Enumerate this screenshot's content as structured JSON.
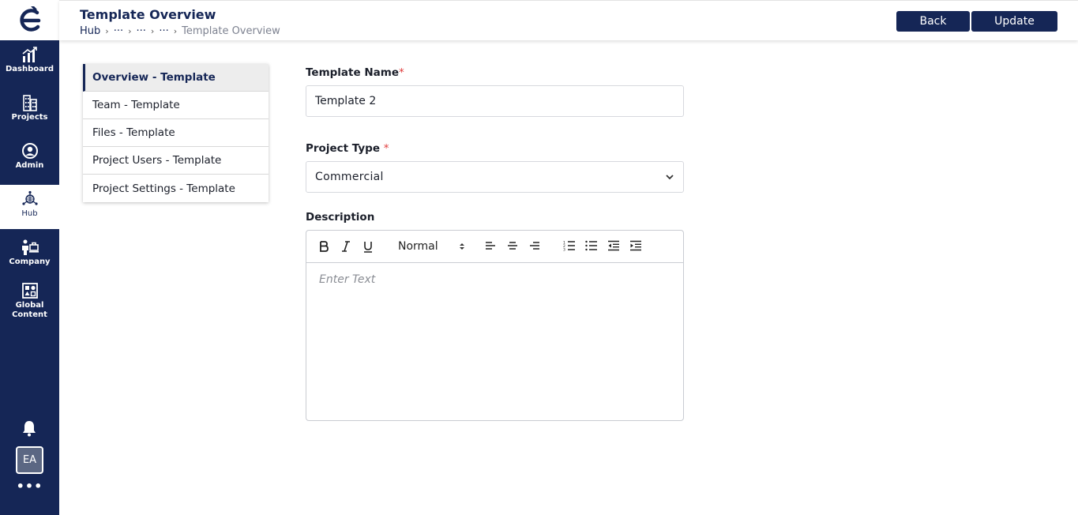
{
  "header": {
    "title": "Template Overview",
    "breadcrumb": [
      "Hub",
      "···",
      "···",
      "···",
      "Template Overview"
    ],
    "back_label": "Back",
    "update_label": "Update"
  },
  "sidebar": {
    "items": [
      {
        "label": "Dashboard",
        "icon": "dashboard-chart-icon"
      },
      {
        "label": "Projects",
        "icon": "buildings-icon"
      },
      {
        "label": "Admin",
        "icon": "user-circle-icon"
      },
      {
        "label": "Hub",
        "icon": "hub-network-icon"
      },
      {
        "label": "Company",
        "icon": "company-icon"
      },
      {
        "label": "Global Content",
        "icon": "global-content-icon"
      }
    ],
    "active": "Hub",
    "avatar_initials": "EA",
    "more_label": "•••"
  },
  "side_menu": {
    "items": [
      "Overview - Template",
      "Team - Template",
      "Files - Template",
      "Project Users - Template",
      "Project Settings - Template"
    ],
    "active_index": 0
  },
  "form": {
    "template_name_label": "Template Name",
    "template_name_value": "Template 2",
    "project_type_label": "Project Type",
    "project_type_value": "Commercial",
    "description_label": "Description",
    "heading_select_value": "Normal",
    "description_placeholder": "Enter Text",
    "required_mark": "*"
  },
  "colors": {
    "brand_navy": "#152656",
    "required_red": "#e03b3b"
  }
}
